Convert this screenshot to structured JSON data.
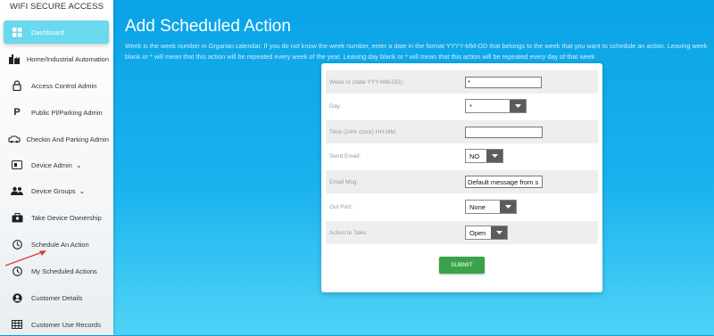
{
  "app": {
    "brand": "WIFI SECURE ACCESS"
  },
  "sidebar": {
    "items": [
      {
        "label": "Dashboard",
        "icon": "dashboard-icon",
        "active": true
      },
      {
        "label": "Home/Industrial Automation",
        "icon": "factory-icon"
      },
      {
        "label": "Access Control Admin",
        "icon": "lock-icon"
      },
      {
        "label": "Public Pl/Parking Admin",
        "icon": "parking-icon"
      },
      {
        "label": "Checkin And Parking Admin",
        "icon": "car-icon"
      },
      {
        "label": "Device Admin",
        "icon": "device-icon",
        "expandable": true
      },
      {
        "label": "Device Groups",
        "icon": "group-icon",
        "expandable": true
      },
      {
        "label": "Take Device Ownership",
        "icon": "ownership-icon"
      },
      {
        "label": "Schedule An Action",
        "icon": "clock-icon"
      },
      {
        "label": "My Scheduled Actions",
        "icon": "clock-icon"
      },
      {
        "label": "Customer Details",
        "icon": "user-circle-icon"
      },
      {
        "label": "Customer Use Records",
        "icon": "table-icon"
      }
    ]
  },
  "main": {
    "title": "Add Scheduled Action",
    "description": "Week is the week number in Grgarian calendar. If you do not know the week number, enter a date in the format YYYY-MM-DD that belongs to the week that you want to schedule an action. Leaving week blank or * will mean that this action will be repeated every week of the year. Leaving day blank or * will mean that this action will be repeated every day of that week"
  },
  "form": {
    "week": {
      "label": "Week or (date YYY-MM-DD):",
      "value": "*"
    },
    "day": {
      "label": "Day:",
      "value": "*"
    },
    "time": {
      "label": "Time (24hr clock) HH:MM:",
      "value": ""
    },
    "send_email": {
      "label": "Send Email:",
      "value": "NO"
    },
    "email_msg": {
      "label": "Email Msg:",
      "value": "Default message from s"
    },
    "out_port": {
      "label": "Out Port:",
      "value": "None"
    },
    "action": {
      "label": "Action to Take:",
      "value": "Open"
    },
    "submit_label": "SUBMIT"
  },
  "colors": {
    "accent_active": "#6ad8ef",
    "submit": "#3aa24a",
    "annotation_arrow": "#e53935"
  }
}
